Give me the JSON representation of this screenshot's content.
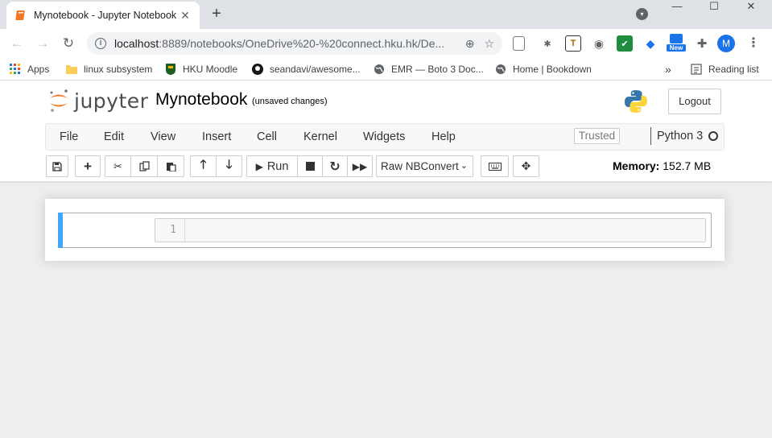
{
  "browser": {
    "tab_title": "Mynotebook - Jupyter Notebook",
    "tab_close": "✕",
    "new_tab": "+",
    "window_controls": {
      "minimize": "—",
      "maximize": "☐",
      "close": "✕"
    },
    "url_host": "localhost",
    "url_rest": ":8889/notebooks/OneDrive%20-%20connect.hku.hk/De...",
    "extension_new_badge": "New",
    "profile_initial": "M",
    "bookmarks": [
      {
        "label": "Apps",
        "icon": "apps-grid-icon"
      },
      {
        "label": "linux subsystem",
        "icon": "folder-icon"
      },
      {
        "label": "HKU Moodle",
        "icon": "hku-crest-icon"
      },
      {
        "label": "seandavi/awesome...",
        "icon": "github-icon"
      },
      {
        "label": "EMR — Boto 3 Doc...",
        "icon": "globe-icon"
      },
      {
        "label": "Home | Bookdown",
        "icon": "globe-icon"
      }
    ],
    "bookmarks_overflow": "»",
    "reading_list": "Reading list"
  },
  "jupyter": {
    "logo_text": "jupyter",
    "notebook_name": "Mynotebook",
    "save_status": "(unsaved changes)",
    "logout_label": "Logout",
    "menu": [
      "File",
      "Edit",
      "View",
      "Insert",
      "Cell",
      "Kernel",
      "Widgets",
      "Help"
    ],
    "trusted_label": "Trusted",
    "kernel_name": "Python 3",
    "toolbar": {
      "run_label": "Run",
      "cell_type": "Raw NBConvert"
    },
    "memory_label": "Memory:",
    "memory_value": "152.7 MB",
    "cell": {
      "line_number": "1",
      "content": ""
    }
  },
  "colors": {
    "tabstrip": "#dee1e6",
    "selected_cell_bar": "#42a5f5",
    "profile": "#1a73e8",
    "jupyter_orange": "#f37726"
  }
}
